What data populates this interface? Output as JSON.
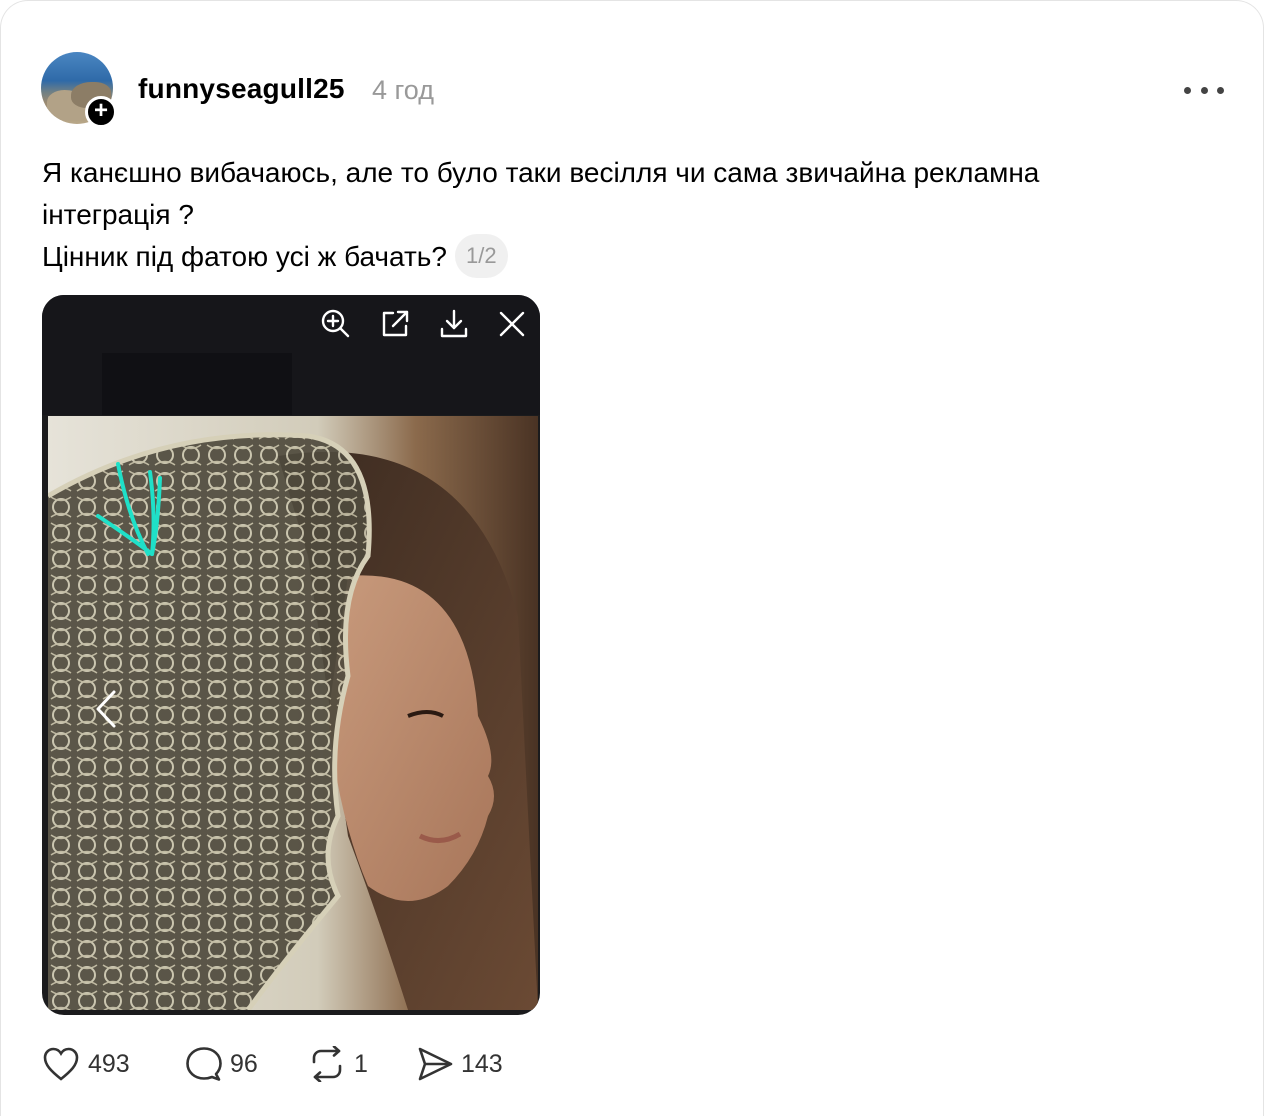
{
  "post": {
    "username": "funnyseagull25",
    "time": "4 год",
    "text_lines": [
      "Я канєшно вибачаюсь, але то було таки весілля чи сама звичайна рекламна",
      "інтеграція ?",
      "Цінник під фатою усі ж бачать?"
    ],
    "image_counter": "1/2"
  },
  "media_viewer": {
    "tools": [
      "zoom-in-icon",
      "open-external-icon",
      "download-icon",
      "close-icon"
    ]
  },
  "actions": {
    "likes": "493",
    "comments": "96",
    "reposts": "1",
    "shares": "143"
  },
  "colors": {
    "annotation_arrow": "#1fe0c8",
    "muted_text": "#999999"
  }
}
